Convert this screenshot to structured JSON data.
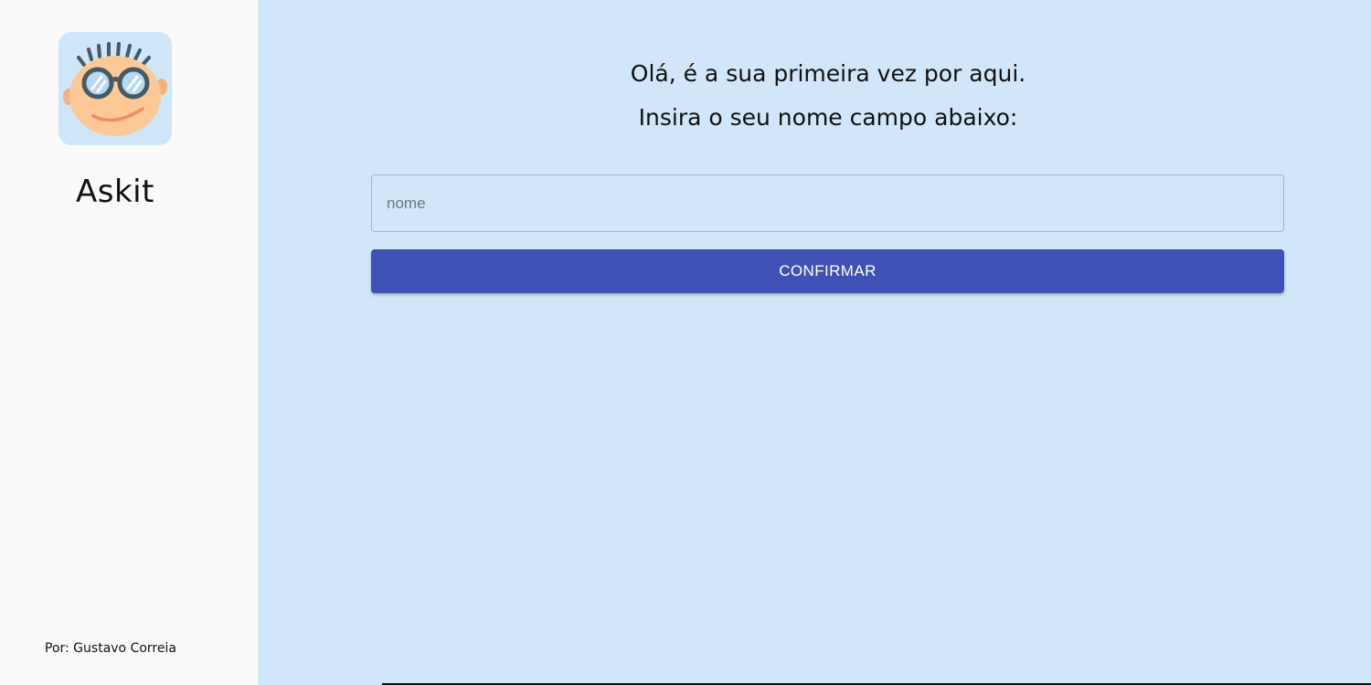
{
  "sidebar": {
    "logo_icon": "glasses-face-icon",
    "app_name": "Askit",
    "author": "Por: Gustavo Correia"
  },
  "main": {
    "greeting": "Olá, é a sua primeira vez por aqui.",
    "instruction": "Insira o seu nome campo abaixo:",
    "name_input": {
      "placeholder": "nome",
      "value": ""
    },
    "confirm_label": "CONFIRMAR"
  },
  "colors": {
    "sidebar_bg": "#fafafa",
    "main_bg": "#d1e6f9",
    "button_bg": "#3f51b5",
    "button_text": "#ffffff",
    "logo_bg": "#cfe5f8",
    "face": "#fdc896"
  }
}
